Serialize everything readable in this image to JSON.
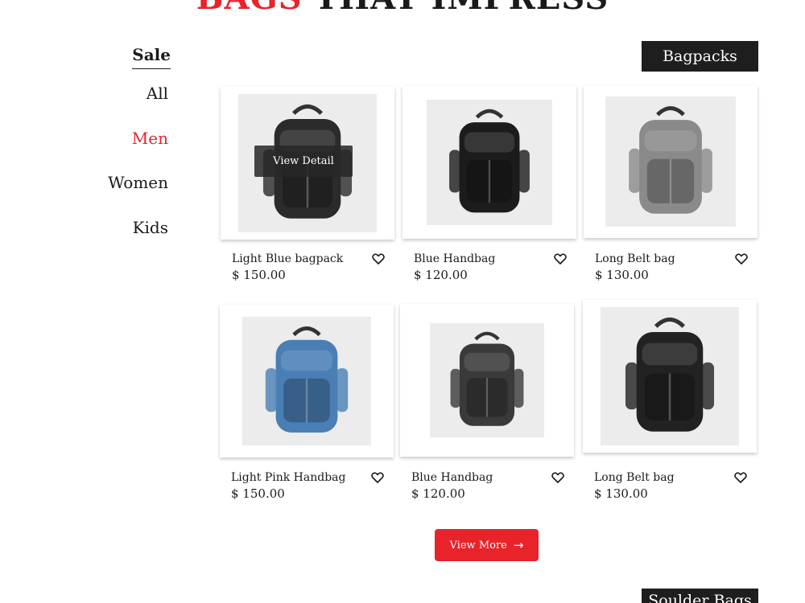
{
  "hero": {
    "accent_text": "BAGS",
    "rest_text": "THAT IMPRESS"
  },
  "sidebar": {
    "heading": "Sale",
    "items": [
      {
        "label": "All",
        "active": false
      },
      {
        "label": "Men",
        "active": true
      },
      {
        "label": "Women",
        "active": false
      },
      {
        "label": "Kids",
        "active": false
      }
    ]
  },
  "sections": [
    {
      "label": "Bagpacks"
    },
    {
      "label": "Soulder Bags"
    }
  ],
  "products": [
    {
      "name": "Light Blue bagpack",
      "price": "$ 150.00",
      "icon": "backpack-photo",
      "bag_color": "#2b2b2b"
    },
    {
      "name": "Blue Handbag",
      "price": "$ 120.00",
      "icon": "backpack-photo",
      "bag_color": "#1c1c1c"
    },
    {
      "name": "Long Belt bag",
      "price": "$ 130.00",
      "icon": "backpack-photo",
      "bag_color": "#8a8a8a"
    },
    {
      "name": "Light Pink Handbag",
      "price": "$ 150.00",
      "icon": "backpack-photo",
      "bag_color": "#4a7fb5"
    },
    {
      "name": "Blue Handbag",
      "price": "$ 120.00",
      "icon": "backpack-photo",
      "bag_color": "#3a3a3a"
    },
    {
      "name": "Long Belt bag",
      "price": "$ 130.00",
      "icon": "backpack-photo",
      "bag_color": "#222222"
    }
  ],
  "overlay": {
    "label": "View Detail"
  },
  "view_more": {
    "label": "View More",
    "icon": "arrow-right-icon"
  },
  "colors": {
    "accent": "#e8232a",
    "dark": "#1e1e1e"
  }
}
